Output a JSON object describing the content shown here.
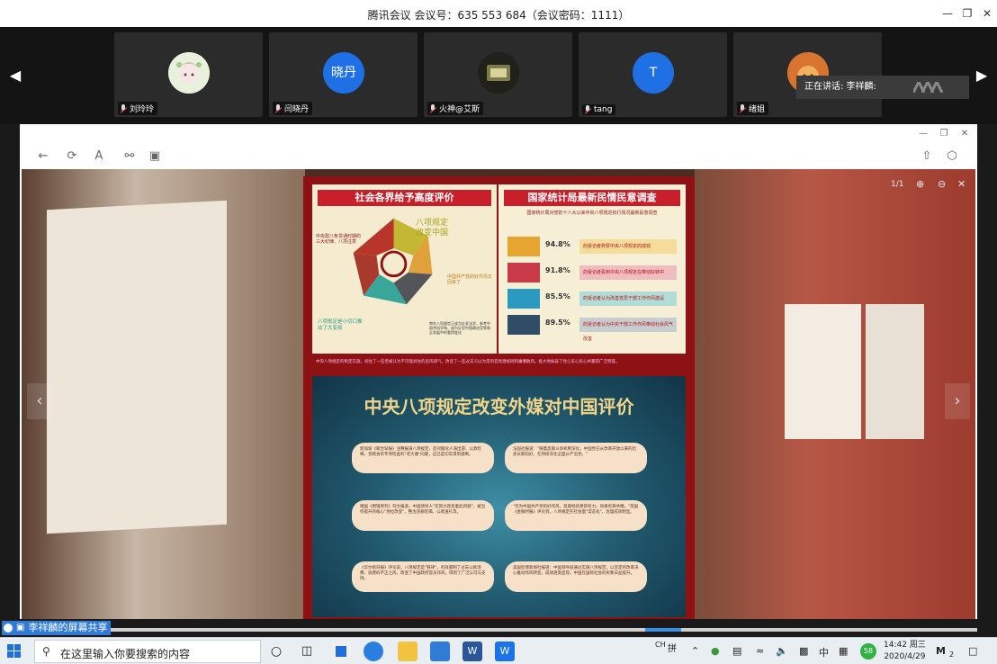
{
  "window": {
    "title": "腾讯会议 会议号：635 553 684（会议密码：1111）"
  },
  "participants": [
    {
      "name": "刘玲玲",
      "avatar_text": ""
    },
    {
      "name": "闫晓丹",
      "avatar_text": "晓丹"
    },
    {
      "name": "火神@艾斯",
      "avatar_text": ""
    },
    {
      "name": "tang",
      "avatar_text": "T"
    },
    {
      "name": "绪姐",
      "avatar_text": ""
    }
  ],
  "speaking": {
    "label": "正在讲话: 李祥麟:"
  },
  "viewer": {
    "page_indicator": "1/1"
  },
  "poster": {
    "left_title": "社会各界给予高度评价",
    "right_title": "国家统计局最新民情民意调查",
    "right_subtitle": "国家统计局对党的十八大以来中央八项规定执行情况最新民意调查",
    "wheel_labels": {
      "top_right": "八项规定\n改变中国",
      "left": "中央政八条贯通时期的三大纪律、八项注意",
      "right": "中国共产党的好作风又回来了",
      "bottom_left": "八项规定是小切口推动了大变局",
      "bottom_right": "审先八项规定正成为反非法学，参考中国共科学和、成为反官中国政治官等和企发展中的看得变化"
    },
    "stats": [
      {
        "pct": "94.8%",
        "text": "的受访者称赞中央八项规定的成效",
        "color": "#e6a531"
      },
      {
        "pct": "91.8%",
        "text": "的受访者看到中央八项规定在带动好转中",
        "color": "#c93a48"
      },
      {
        "pct": "85.5%",
        "text": "的受访者认为改善党员干部工作作风建设",
        "color": "#2a9ac0"
      },
      {
        "pct": "89.5%",
        "text": "的受访者认为中央干部工作作风带动社会风气改善",
        "color": "#2f4d66"
      }
    ],
    "note": "中央八项规定的制定实施，刹住了一些曾被认为不可能刹住的歪风邪气，改变了一些过去习以为常的官场潜规则和庸懒散风，极大地振奋了党心军心民心并赢得广泛赞誉。",
    "bottom_title": "中央八项规定改变外媒对中国评价",
    "bubbles": [
      "新加坡《联合早报》注释报道八项规定，反对腐化人海出游、公款吃喝、党政会有专项检查的\"老大难\"问题，这已是切实得到遏制。",
      "法国社报道：\"随着反腐斗争机制深化，中国党已从改革开放以来的历史长期向好，在持续深化全面从严治党。\"",
      "德国《明镜周刊》刊文报道，中国领导人\"在努力改变着此风貌\"，被当作提升的核心\"地位改变\"，整治违规吃喝、公款送礼等。",
      "\"作为中国共产党的好作风，反腐经验更新有力，效果有目共睹。\"英国《金融时报》评论到，八项规定在社会面\"常态化\"，治理成效明显。",
      "《华尔街日报》评论说，八项规定是\"铁律\"，有效遏制了过去公款消费、浪费的不正之风，改变了中国政府官员作风，得到了广泛认可与支持。",
      "美国彭博新闻社报道：中国领导层通过实施八项规定，以坚定的改革决心推动作风转变，成效逐渐显现，中国在国际社会的形象日益提升。"
    ]
  },
  "share_label": "李祥麟的屏幕共享",
  "taskbar": {
    "search_placeholder": "在这里输入你要搜索的内容",
    "ime_mode": "CH",
    "ime_text": "拼",
    "lang": "中",
    "badge": "58",
    "time": "14:42 周三",
    "date": "2020/4/29",
    "tray_badge": "2"
  }
}
